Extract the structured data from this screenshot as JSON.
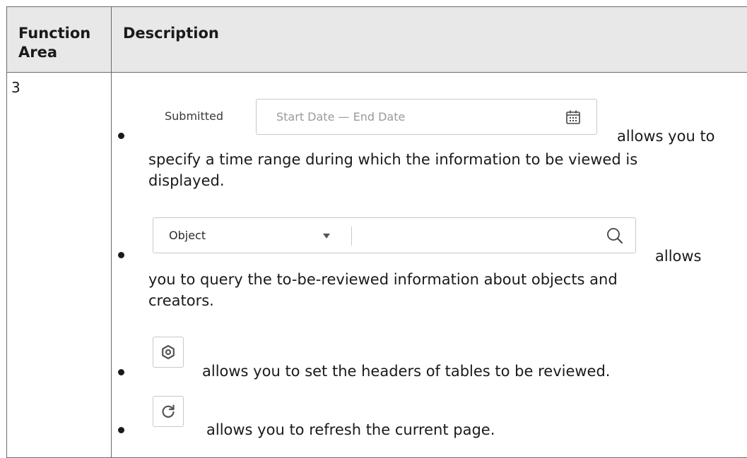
{
  "table": {
    "header": {
      "function_area": "Function Area",
      "description": "Description"
    },
    "row": {
      "function_area": "3"
    }
  },
  "items": [
    {
      "widget": {
        "label": "Submitted",
        "placeholder": "Start Date — End Date",
        "icon": "calendar-icon"
      },
      "text_line1": "allows you to",
      "text_line2": "specify a time range during which the information to be viewed is",
      "text_line3": "displayed."
    },
    {
      "widget": {
        "select_value": "Object",
        "icon": "search-icon"
      },
      "text_line1": "allows",
      "text_line2": "you to query the to-be-reviewed information about objects and",
      "text_line3": "creators."
    },
    {
      "widget": {
        "icon": "settings-icon"
      },
      "text": "allows you to set the headers of tables to be reviewed."
    },
    {
      "widget": {
        "icon": "refresh-icon"
      },
      "text": "allows you to refresh the current page."
    }
  ]
}
